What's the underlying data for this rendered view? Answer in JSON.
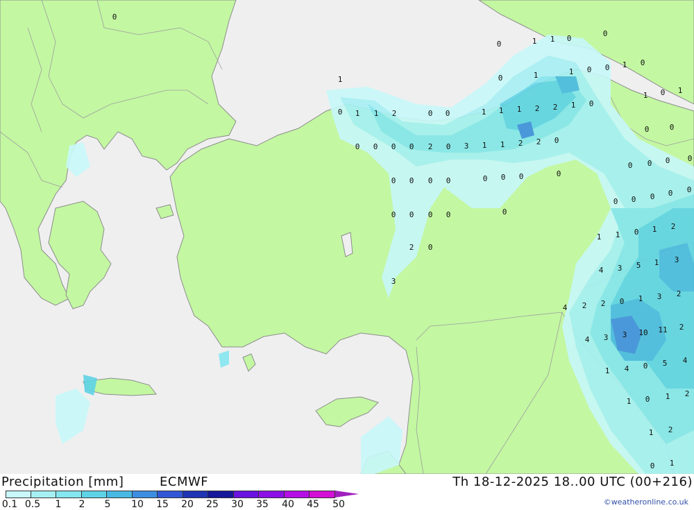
{
  "title": "Precipitation [mm]",
  "model": "ECMWF",
  "valid_time": "Th 18-12-2025 18..00 UTC (00+216)",
  "credit": "©weatheronline.co.uk",
  "legend": {
    "labels": [
      "0.1",
      "0.5",
      "1",
      "2",
      "5",
      "10",
      "15",
      "20",
      "25",
      "30",
      "35",
      "40",
      "45",
      "50"
    ],
    "colors": [
      "#c8f8fa",
      "#a6f0f4",
      "#84e6ee",
      "#5fd3e6",
      "#48b9e3",
      "#3d8ee0",
      "#3257d6",
      "#2035b4",
      "#16179a",
      "#6a12e0",
      "#8c10e6",
      "#b40fe4",
      "#d40fd6",
      "#a11fbf"
    ]
  },
  "colors": {
    "land": "#c3f7a2",
    "sea": "#efefef",
    "border": "#9e9e9e",
    "coast": "#8c8c8c"
  },
  "map": {
    "values": [
      "0",
      "0",
      "1",
      "1",
      "0",
      "0",
      "1",
      "0",
      "1",
      "1",
      "0",
      "0",
      "1",
      "0",
      "0",
      "1",
      "1",
      "2",
      "0",
      "0",
      "1",
      "1",
      "1",
      "2",
      "2",
      "1",
      "0",
      "0",
      "0",
      "0",
      "0",
      "2",
      "0",
      "3",
      "1",
      "1",
      "2",
      "2",
      "0",
      "1",
      "0",
      "1",
      "0",
      "0",
      "0",
      "0",
      "0",
      "0",
      "0",
      "0",
      "0",
      "0",
      "0",
      "0",
      "0",
      "0",
      "0",
      "0",
      "0",
      "0",
      "0",
      "0",
      "0",
      "0",
      "0",
      "0",
      "2",
      "0",
      "1",
      "1",
      "0",
      "1",
      "2",
      "3",
      "4",
      "3",
      "5",
      "1",
      "3",
      "4",
      "2",
      "2",
      "0",
      "1",
      "3",
      "2",
      "4",
      "3",
      "3",
      "10",
      "11",
      "2",
      "1",
      "4",
      "0",
      "5",
      "4",
      "1",
      "0",
      "1",
      "2",
      "1",
      "2",
      "0",
      "1",
      "1"
    ]
  }
}
